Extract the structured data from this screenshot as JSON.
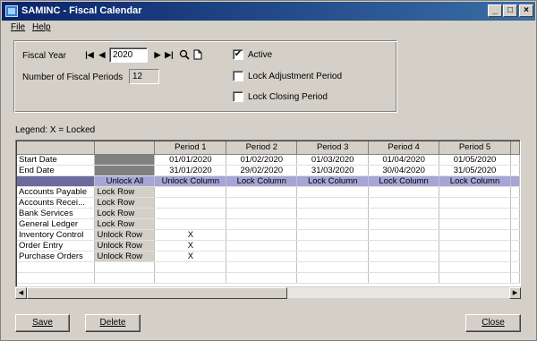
{
  "window": {
    "title": "SAMINC - Fiscal Calendar",
    "controls": {
      "minimize": "_",
      "maximize": "□",
      "close": "×"
    }
  },
  "menu": [
    {
      "label": "File",
      "mnemonic": "F"
    },
    {
      "label": "Help",
      "mnemonic": "H"
    }
  ],
  "form": {
    "fiscal_year_label": "Fiscal Year",
    "fiscal_year_value": "2020",
    "num_periods_label": "Number of Fiscal Periods",
    "num_periods_value": "12",
    "active_label": "Active",
    "active_checked": true,
    "lock_adjustment_label": "Lock Adjustment Period",
    "lock_adjustment_checked": false,
    "lock_closing_label": "Lock Closing Period",
    "lock_closing_checked": false
  },
  "icons": {
    "first": "first-icon",
    "prev": "prev-icon",
    "next": "next-icon",
    "last": "last-icon",
    "search": "search-icon",
    "doc": "document-icon"
  },
  "legend": "Legend: X = Locked",
  "grid": {
    "periods": [
      "Period 1",
      "Period 2",
      "Period 3",
      "Period 4",
      "Period 5"
    ],
    "start_label": "Start Date",
    "start_dates": [
      "01/01/2020",
      "01/02/2020",
      "01/03/2020",
      "01/04/2020",
      "01/05/2020"
    ],
    "end_label": "End Date",
    "end_dates": [
      "31/01/2020",
      "29/02/2020",
      "31/03/2020",
      "30/04/2020",
      "31/05/2020"
    ],
    "unlock_all": "Unlock All",
    "column_actions": [
      "Unlock Column",
      "Lock Column",
      "Lock Column",
      "Lock Column",
      "Lock Column"
    ],
    "rows": [
      {
        "name": "Accounts Payable",
        "action": "Lock Row",
        "locked": [
          "",
          "",
          "",
          "",
          ""
        ]
      },
      {
        "name": "Accounts Recei...",
        "action": "Lock Row",
        "locked": [
          "",
          "",
          "",
          "",
          ""
        ]
      },
      {
        "name": "Bank Services",
        "action": "Lock Row",
        "locked": [
          "",
          "",
          "",
          "",
          ""
        ]
      },
      {
        "name": "General Ledger",
        "action": "Lock Row",
        "locked": [
          "",
          "",
          "",
          "",
          ""
        ]
      },
      {
        "name": "Inventory Control",
        "action": "Unlock Row",
        "locked": [
          "X",
          "",
          "",
          "",
          ""
        ]
      },
      {
        "name": "Order Entry",
        "action": "Unlock Row",
        "locked": [
          "X",
          "",
          "",
          "",
          ""
        ]
      },
      {
        "name": "Purchase Orders",
        "action": "Unlock Row",
        "locked": [
          "X",
          "",
          "",
          "",
          ""
        ]
      }
    ]
  },
  "buttons": {
    "save": "Save",
    "delete": "Delete",
    "close": "Close"
  },
  "colors": {
    "title_start": "#0a246a",
    "title_end": "#3a6ea5",
    "selection_row": "#a6a6d6"
  }
}
